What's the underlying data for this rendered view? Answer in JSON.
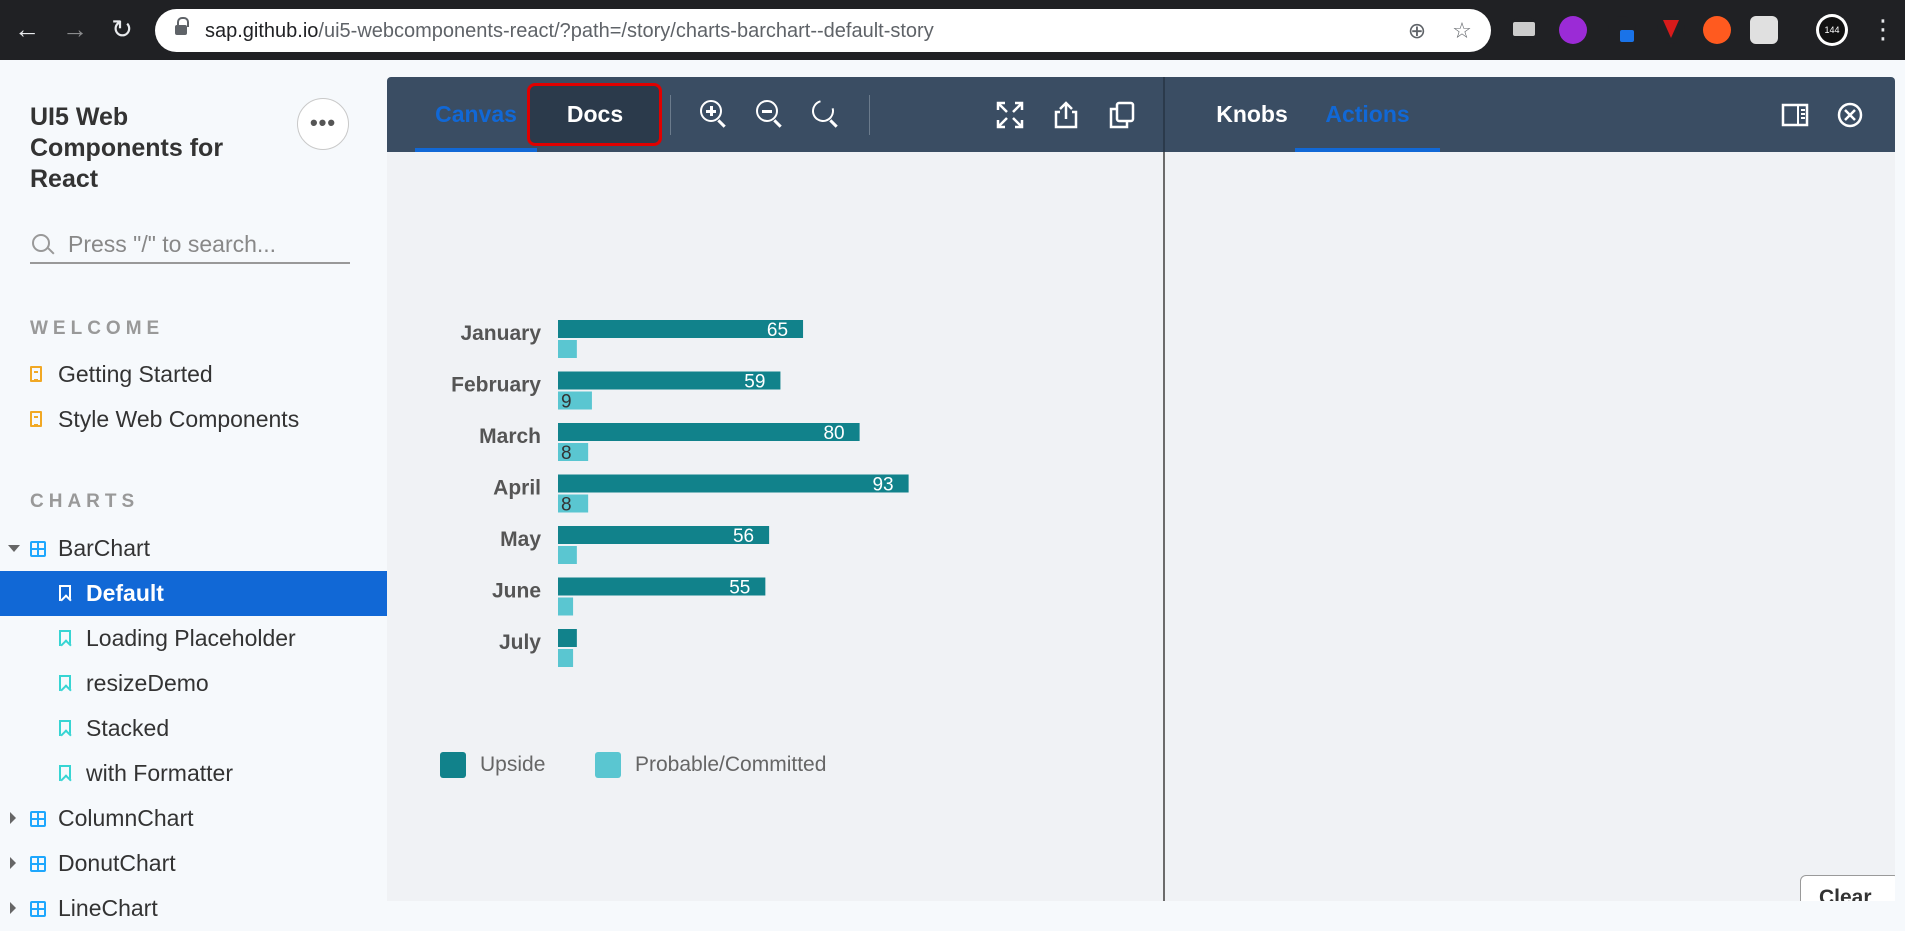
{
  "browser": {
    "url_host": "sap.github.io",
    "url_path": "/ui5-webcomponents-react/?path=/story/charts-barchart--default-story",
    "tab_badge": "144"
  },
  "sidebar": {
    "brand_title": "UI5 Web Components for React",
    "more_label": "•••",
    "search_placeholder": "Press \"/\" to search...",
    "welcome_title": "WELCOME",
    "welcome_items": [
      {
        "label": "Getting Started"
      },
      {
        "label": "Style Web Components"
      }
    ],
    "charts_title": "CHARTS",
    "bar_chart": {
      "label": "BarChart"
    },
    "stories": [
      {
        "label": "Default",
        "selected": true
      },
      {
        "label": "Loading Placeholder"
      },
      {
        "label": "resizeDemo"
      },
      {
        "label": "Stacked"
      },
      {
        "label": "with Formatter"
      }
    ],
    "more_components": [
      {
        "label": "ColumnChart"
      },
      {
        "label": "DonutChart"
      },
      {
        "label": "LineChart"
      }
    ]
  },
  "toolbar": {
    "canvas_tab": "Canvas",
    "docs_tab": "Docs",
    "knobs_tab": "Knobs",
    "actions_tab": "Actions"
  },
  "addon": {
    "clear_label": "Clear"
  },
  "colors": {
    "upside": "#11828b",
    "probable": "#5ac6d1",
    "accent": "#1168d6",
    "toolbar": "#3a4d63"
  },
  "chart_data": {
    "type": "bar",
    "orientation": "horizontal",
    "categories": [
      "January",
      "February",
      "March",
      "April",
      "May",
      "June",
      "July"
    ],
    "series": [
      {
        "name": "Upside",
        "values": [
          65,
          59,
          80,
          93,
          56,
          55,
          5
        ]
      },
      {
        "name": "Probable/Committed",
        "values": [
          5,
          9,
          8,
          8,
          5,
          4,
          4
        ]
      }
    ],
    "value_labels": [
      [
        "65",
        "59",
        "80",
        "93",
        "56",
        "55",
        ""
      ],
      [
        "",
        "9",
        "8",
        "8",
        "",
        "",
        ""
      ]
    ],
    "xlim": [
      0,
      100
    ],
    "grid": false,
    "legend_position": "bottom-left"
  }
}
